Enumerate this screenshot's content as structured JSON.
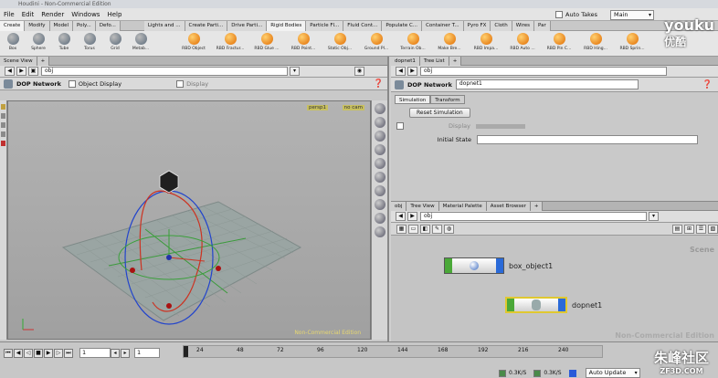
{
  "window": {
    "title": "Houdini - Non-Commercial Edition"
  },
  "menu": [
    "File",
    "Edit",
    "Render",
    "Windows",
    "Help"
  ],
  "desk": {
    "auto_takes": "Auto Takes",
    "desk_name": "Main"
  },
  "shelf_tabs_left": [
    "Create",
    "Modify",
    "Model",
    "Poly...",
    "Defo..."
  ],
  "shelf_tabs_right": [
    "Lights and ...",
    "Create Parti...",
    "Drive Parti...",
    "Rigid Bodies",
    "Particle Fl...",
    "Fluid Cont...",
    "Populate C...",
    "Container T...",
    "Pyro FX",
    "Cloth",
    "Wires",
    "Par"
  ],
  "shelf_tools_left": [
    "Box",
    "Sphere",
    "Tube",
    "Torus",
    "Grid",
    "Metab..."
  ],
  "shelf_tools_right": [
    "RBD Object",
    "RBD Fractur...",
    "RBD Glue ...",
    "RBD Point...",
    "Static Obj...",
    "Ground Pl...",
    "Terrain Ob...",
    "Make Bre...",
    "RBD Impa...",
    "RBD Auto ...",
    "RBD Pin C...",
    "RBD Hing...",
    "RBD Sprin..."
  ],
  "scene_view": {
    "tab": "Scene View",
    "path": "obj",
    "network_label": "DOP Network",
    "object_display": "Object Display",
    "display": "Display",
    "cam_persp": "persp1",
    "cam_nocam": "no cam",
    "watermark": "Non-Commercial Edition"
  },
  "params": {
    "tabs": [
      "dopnet1",
      "Tree List"
    ],
    "network_label": "DOP Network",
    "name": "dopnet1",
    "subtabs": [
      "Simulation",
      "Transform"
    ],
    "reset": "Reset Simulation",
    "display": "Display",
    "initial_state": "Initial State"
  },
  "network": {
    "tabs": [
      "obj",
      "Tree View",
      "Material Palette",
      "Asset Browser"
    ],
    "path": "obj",
    "scene_label": "Scene",
    "nodes": [
      "box_object1",
      "dopnet1"
    ],
    "watermark": "Non-Commercial Edition"
  },
  "timeline": {
    "frame": "1",
    "start": "1",
    "ticks": [
      "24",
      "48",
      "72",
      "96",
      "120",
      "144",
      "168",
      "192",
      "216",
      "240"
    ],
    "ram1": "0.3K/S",
    "ram2": "0.3K/S",
    "auto_update": "Auto Update"
  },
  "overlay": {
    "youku": "youku",
    "youku_cn": "优酷",
    "site": "朱峰社区",
    "site_url": "ZF3D.COM"
  }
}
